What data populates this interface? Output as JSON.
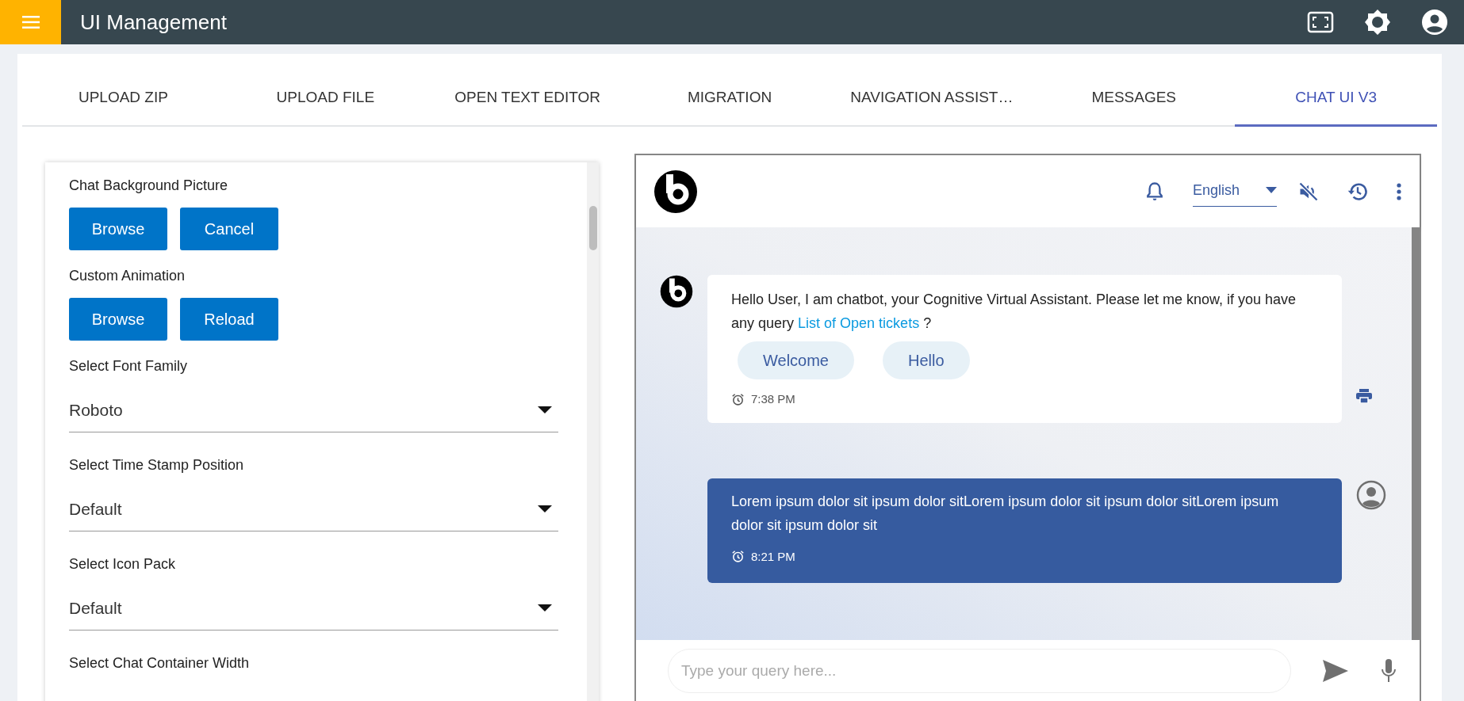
{
  "app_bar": {
    "title": "UI Management"
  },
  "tabs": [
    {
      "label": "UPLOAD ZIP",
      "selected": false
    },
    {
      "label": "UPLOAD FILE",
      "selected": false
    },
    {
      "label": "OPEN TEXT EDITOR",
      "selected": false
    },
    {
      "label": "MIGRATION",
      "selected": false
    },
    {
      "label": "NAVIGATION ASSIST…",
      "selected": false
    },
    {
      "label": "MESSAGES",
      "selected": false
    },
    {
      "label": "CHAT UI V3",
      "selected": true
    }
  ],
  "settings": [
    {
      "kind": "buttons",
      "label": "Chat Background Picture",
      "buttons": [
        "Browse",
        "Cancel"
      ]
    },
    {
      "kind": "buttons",
      "label": "Custom Animation",
      "buttons": [
        "Browse",
        "Reload"
      ]
    },
    {
      "kind": "select",
      "label": "Select Font Family",
      "value": "Roboto"
    },
    {
      "kind": "select",
      "label": "Select Time Stamp Position",
      "value": "Default"
    },
    {
      "kind": "select",
      "label": "Select Icon Pack",
      "value": "Default"
    },
    {
      "kind": "label",
      "label": "Select Chat Container Width"
    }
  ],
  "chat": {
    "language": "English",
    "messages": [
      {
        "kind": "bot",
        "text": "Hello User, I am chatbot, your Cognitive Virtual Assistant. Please let me know, if you have any query ",
        "link": "List of Open tickets",
        "suffix": " ?",
        "quick_replies": [
          "Welcome",
          "Hello"
        ],
        "time": "7:38 PM"
      },
      {
        "kind": "user",
        "text": "Lorem ipsum dolor sit ipsum dolor sitLorem ipsum dolor sit ipsum dolor sitLorem ipsum dolor sit ipsum dolor sit",
        "time": "8:21 PM"
      }
    ],
    "input": {
      "placeholder": "Type your query here..."
    }
  }
}
